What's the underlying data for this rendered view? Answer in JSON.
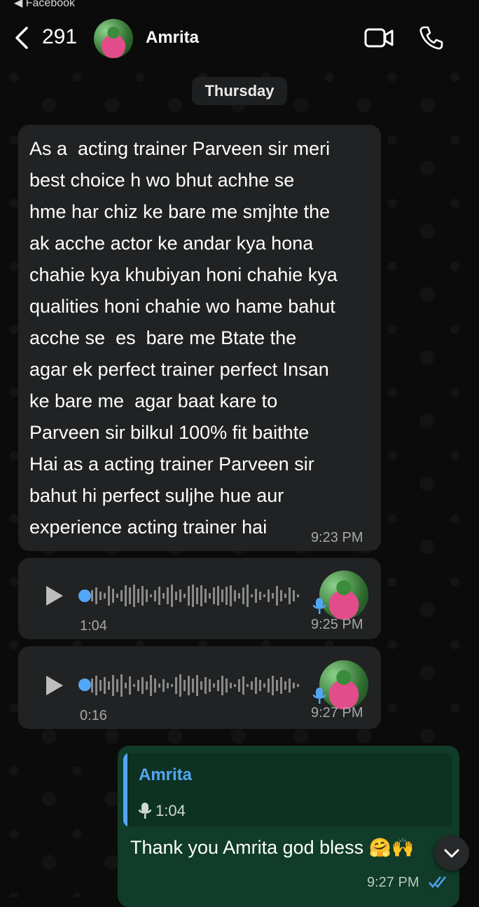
{
  "status_bar": {
    "back_to_app": "◀ Facebook"
  },
  "header": {
    "unread_count": "291",
    "contact_name": "Amrita"
  },
  "date_separator": "Thursday",
  "messages": {
    "text_message": {
      "text": "As a  acting trainer Parveen sir meri\nbest choice h wo bhut achhe se\nhme har chiz ke bare me smjhte the\nak acche actor ke andar kya hona\nchahie kya khubiyan honi chahie kya\nqualities honi chahie wo hame bahut\nacche se  es  bare me Btate the\nagar ek perfect trainer perfect Insan\nke bare me  agar baat kare to\nParveen sir bilkul 100% fit baithte\nHai as a acting trainer Parveen sir\nbahut hi perfect suljhe hue aur\nexperience acting trainer hai",
      "time": "9:23 PM"
    },
    "voice_1": {
      "duration": "1:04",
      "time": "9:25 PM"
    },
    "voice_2": {
      "duration": "0:16",
      "time": "9:27 PM"
    },
    "outgoing": {
      "quote_name": "Amrita",
      "quote_duration": "1:04",
      "text": "Thank you Amrita god bless ",
      "emojis": "🤗🙌",
      "time": "9:27 PM"
    }
  },
  "colors": {
    "accent_blue": "#53a6f6",
    "incoming_bubble": "#202223",
    "outgoing_bubble": "#103c29"
  }
}
